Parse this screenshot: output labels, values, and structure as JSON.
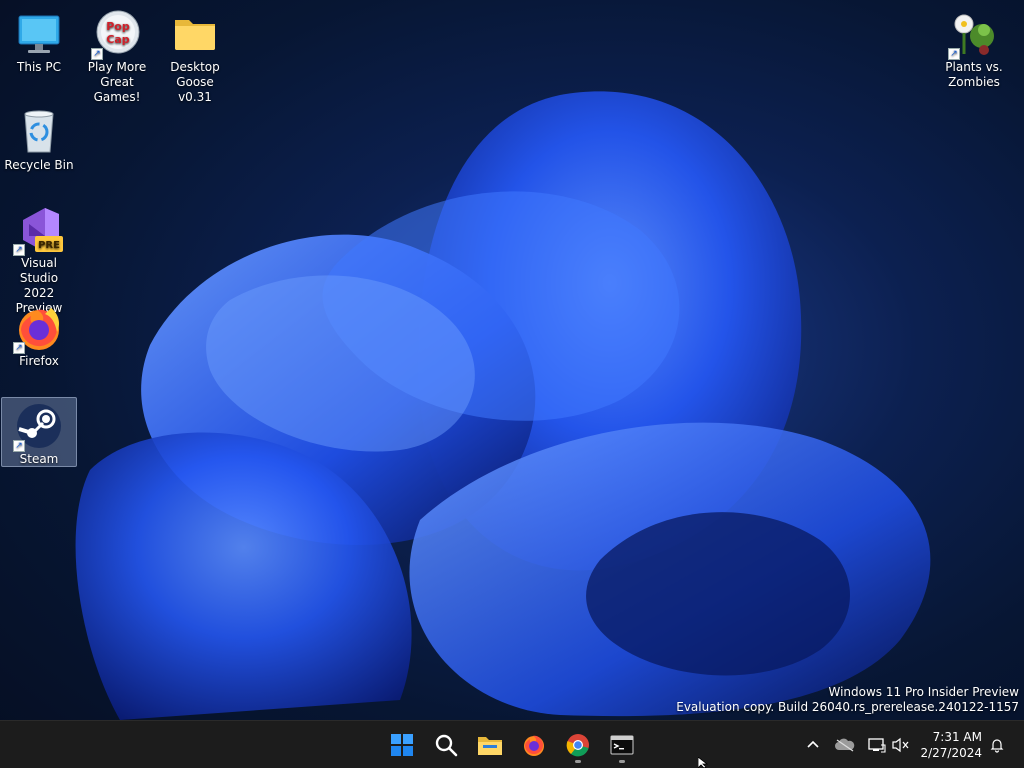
{
  "desktop": {
    "icons": [
      {
        "label": "This PC",
        "icon": "monitor-icon"
      },
      {
        "label": "Play More\nGreat Games!",
        "icon": "popcap-icon"
      },
      {
        "label": "Desktop\nGoose v0.31",
        "icon": "folder-icon"
      },
      {
        "label": "Recycle Bin",
        "icon": "recycle-bin-icon"
      },
      {
        "label": "Visual Studio\n2022 Preview",
        "icon": "visual-studio-icon",
        "badge": "PRE"
      },
      {
        "label": "Firefox",
        "icon": "firefox-icon"
      },
      {
        "label": "Steam",
        "icon": "steam-icon"
      },
      {
        "label": "Plants vs.\nZombies",
        "icon": "plants-vs-zombies-icon"
      }
    ],
    "popcap_text": [
      "Pop",
      "Cap"
    ],
    "watermark": {
      "line1": "Windows 11 Pro Insider Preview",
      "line2": "Evaluation copy. Build 26040.rs_prerelease.240122-1157"
    }
  },
  "taskbar": {
    "apps": [
      "start-icon",
      "search-icon",
      "file-explorer-icon",
      "firefox-icon",
      "chrome-icon",
      "terminal-icon"
    ],
    "tray": [
      "chevron-up-icon",
      "onedrive-icon",
      "network-icon",
      "volume-muted-icon"
    ],
    "time": "7:31 AM",
    "date": "2/27/2024",
    "accent": "#0078d4"
  }
}
